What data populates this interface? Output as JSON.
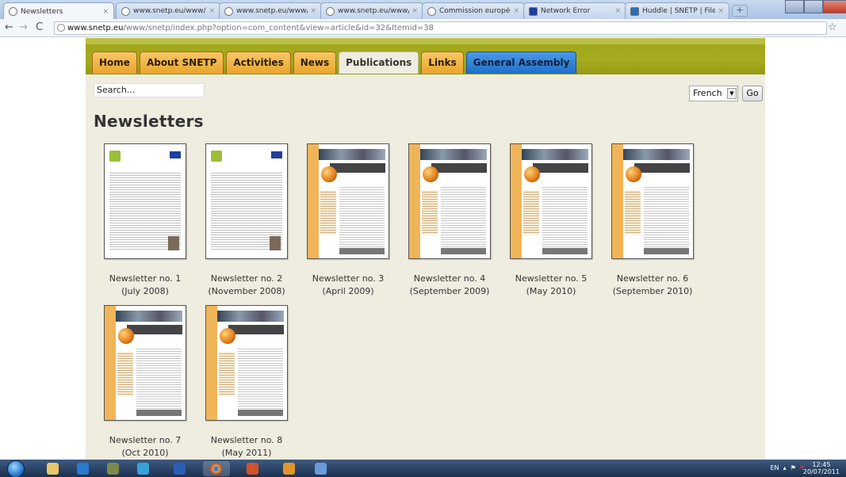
{
  "browser": {
    "tabs": [
      {
        "label": "Newsletters",
        "active": true
      },
      {
        "label": "www.snetp.eu/www/snetp"
      },
      {
        "label": "www.snetp.eu/www/snetp"
      },
      {
        "label": "www.snetp.eu/www/snetp"
      },
      {
        "label": "Commission européenne"
      },
      {
        "label": "Network Error"
      },
      {
        "label": "Huddle | SNETP | Files"
      }
    ],
    "url_host": "www.snetp.eu",
    "url_path": "/www/snetp/index.php?option=com_content&view=article&id=32&Itemid=38"
  },
  "menu": {
    "items": [
      {
        "label": "Home"
      },
      {
        "label": "About SNETP"
      },
      {
        "label": "Activities"
      },
      {
        "label": "News"
      },
      {
        "label": "Publications",
        "active": true
      },
      {
        "label": "Links"
      },
      {
        "label": "General Assembly"
      }
    ]
  },
  "search": {
    "value": "Search..."
  },
  "language": {
    "selected": "French",
    "go_label": "Go"
  },
  "page": {
    "title": "Newsletters"
  },
  "newsletters": [
    {
      "title": "Newsletter no. 1",
      "date": "(July 2008)"
    },
    {
      "title": "Newsletter no. 2",
      "date": "(November 2008)"
    },
    {
      "title": "Newsletter no. 3",
      "date": "(April 2009)"
    },
    {
      "title": "Newsletter no. 4",
      "date": "(September 2009)"
    },
    {
      "title": "Newsletter no. 5",
      "date": "(May 2010)"
    },
    {
      "title": "Newsletter no. 6",
      "date": "(September 2010)"
    },
    {
      "title": "Newsletter no. 7",
      "date": "(Oct 2010)"
    },
    {
      "title": "Newsletter no. 8",
      "date": "(May 2011)"
    }
  ],
  "taskbar": {
    "lang": "EN",
    "time": "12:45",
    "date": "20/07/2011"
  },
  "colors": {
    "accent_orange": "#e9a52c",
    "green_header": "#a6ac1e",
    "page_bg": "#efece0",
    "blue_tab": "#1f6fc7"
  }
}
